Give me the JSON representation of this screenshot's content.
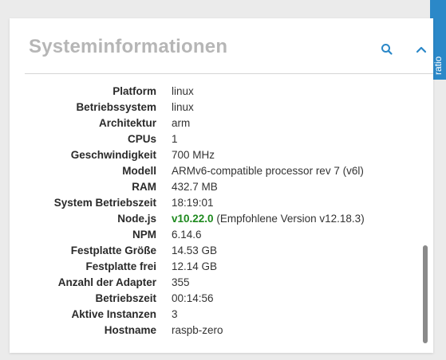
{
  "side_tab": {
    "label": "ratio"
  },
  "card": {
    "title": "Systeminformationen",
    "accent_color": "#2b88c8",
    "buttons": [
      {
        "name": "search",
        "icon": "search-icon"
      },
      {
        "name": "collapse",
        "icon": "chevron-up-icon"
      }
    ]
  },
  "info": {
    "rows": [
      {
        "label": "Platform",
        "value": "linux"
      },
      {
        "label": "Betriebssystem",
        "value": "linux"
      },
      {
        "label": "Architektur",
        "value": "arm"
      },
      {
        "label": "CPUs",
        "value": "1"
      },
      {
        "label": "Geschwindigkeit",
        "value": "700 MHz"
      },
      {
        "label": "Modell",
        "value": "ARMv6-compatible processor rev 7 (v6l)"
      },
      {
        "label": "RAM",
        "value": "432.7 MB"
      },
      {
        "label": "System Betriebszeit",
        "value": "18:19:01"
      },
      {
        "label": "Node.js",
        "value": "v10.22.0",
        "note": "(Empfohlene Version v12.18.3)",
        "value_color": "#1e8a1e"
      },
      {
        "label": "NPM",
        "value": "6.14.6"
      },
      {
        "label": "Festplatte Größe",
        "value": "14.53 GB"
      },
      {
        "label": "Festplatte frei",
        "value": "12.14 GB"
      },
      {
        "label": "Anzahl der Adapter",
        "value": "355"
      },
      {
        "label": "Betriebszeit",
        "value": "00:14:56"
      },
      {
        "label": "Aktive Instanzen",
        "value": "3"
      },
      {
        "label": "Hostname",
        "value": "raspb-zero"
      }
    ]
  }
}
